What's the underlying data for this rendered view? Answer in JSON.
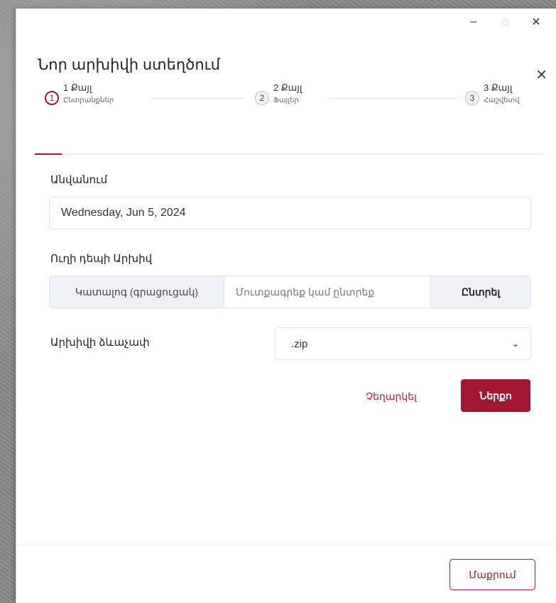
{
  "window_controls": {
    "minimize": "–",
    "maximize": "□",
    "close": "✕"
  },
  "dialog": {
    "title": "Նոր արխիվի ստեղծում",
    "close": "✕"
  },
  "steps": [
    {
      "number": "1",
      "title": "1 Քայլ",
      "subtitle": "Ընտրանքներ",
      "active": true
    },
    {
      "number": "2",
      "title": "2 Քայլ",
      "subtitle": "Ֆայլեր",
      "active": false
    },
    {
      "number": "3",
      "title": "3 Քայլ",
      "subtitle": "Հաշվետվ",
      "active": false
    }
  ],
  "form": {
    "name_label": "Անվանում",
    "name_value": "Wednesday, Jun 5, 2024",
    "path_label": "Ուղի դեպի Արխիվ",
    "path_addon": "Կատալոգ (գրացուցակ)",
    "path_placeholder": "Մուտքագրեք կամ ընտրեք",
    "browse_label": "Ընտրել",
    "format_label": "Արխիվի ձևաչափ",
    "format_value": ".zip"
  },
  "actions": {
    "cancel_label": "Չեղարկել",
    "next_label": "Ներքո"
  },
  "footer": {
    "clear_label": "Մաքրում"
  },
  "colors": {
    "accent": "#a3162f",
    "addon_bg": "#eef2f7"
  }
}
